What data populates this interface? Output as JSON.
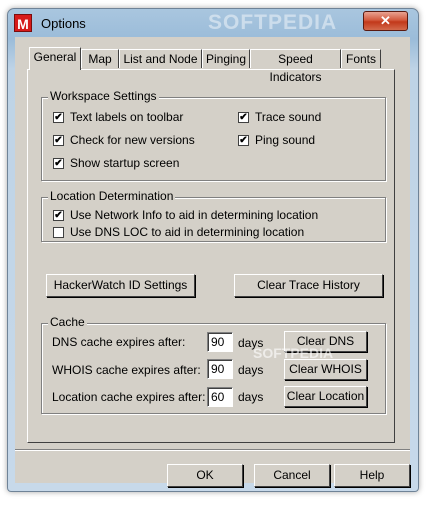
{
  "window": {
    "title": "Options",
    "app_icon_letter": "M",
    "watermark": "SOFTPEDIA",
    "close_symbol": "✕"
  },
  "tabs": [
    {
      "label": "General",
      "active": true
    },
    {
      "label": "Map",
      "active": false
    },
    {
      "label": "List and Node",
      "active": false
    },
    {
      "label": "Pinging",
      "active": false
    },
    {
      "label": "Speed Indicators",
      "active": false
    },
    {
      "label": "Fonts",
      "active": false
    }
  ],
  "workspace": {
    "legend": "Workspace Settings",
    "text_labels": {
      "label": "Text labels on toolbar",
      "checked": true
    },
    "check_versions": {
      "label": "Check for new versions",
      "checked": true
    },
    "startup_screen": {
      "label": "Show startup screen",
      "checked": true
    },
    "trace_sound": {
      "label": "Trace sound",
      "checked": true
    },
    "ping_sound": {
      "label": "Ping sound",
      "checked": true
    }
  },
  "location": {
    "legend": "Location Determination",
    "network_info": {
      "label": "Use Network Info to aid in determining location",
      "checked": true
    },
    "dns_loc": {
      "label": "Use DNS LOC to aid in determining location",
      "checked": false
    }
  },
  "buttons": {
    "hackerwatch": "HackerWatch ID Settings",
    "clear_trace": "Clear Trace History"
  },
  "cache": {
    "legend": "Cache",
    "units": "days",
    "dns": {
      "label": "DNS cache expires after:",
      "value": "90",
      "button": "Clear DNS"
    },
    "whois": {
      "label": "WHOIS cache expires after:",
      "value": "90",
      "button": "Clear WHOIS"
    },
    "location": {
      "label": "Location cache expires after:",
      "value": "60",
      "button": "Clear Location"
    }
  },
  "footer": {
    "ok": "OK",
    "cancel": "Cancel",
    "help": "Help"
  },
  "check_glyph": "✔",
  "watermark_center": "SOFTPEDIA"
}
